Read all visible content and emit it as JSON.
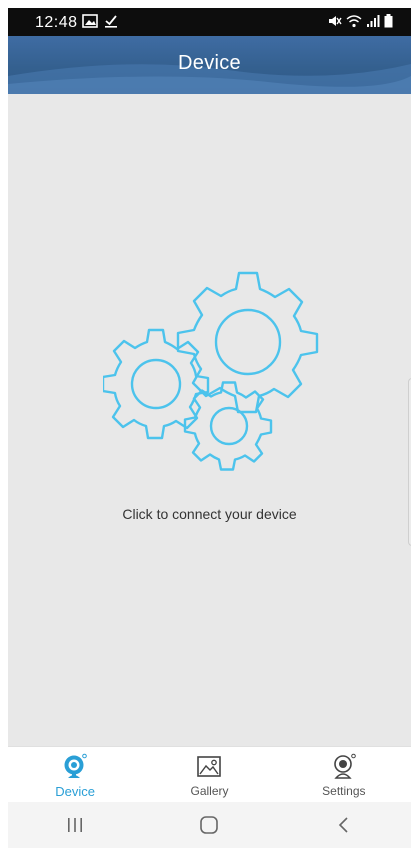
{
  "status_bar": {
    "time": "12:48"
  },
  "header": {
    "title": "Device"
  },
  "main": {
    "connect_text": "Click to connect your device"
  },
  "tabs": [
    {
      "label": "Device",
      "icon": "camera-icon",
      "active": true
    },
    {
      "label": "Gallery",
      "icon": "gallery-icon",
      "active": false
    },
    {
      "label": "Settings",
      "icon": "settings-camera-icon",
      "active": false
    }
  ],
  "nav": {
    "recents": "recents-icon",
    "home": "home-icon",
    "back": "back-icon"
  },
  "colors": {
    "accent": "#2a9fd6",
    "gear": "#4cc3ec",
    "header": "#3a6799"
  }
}
